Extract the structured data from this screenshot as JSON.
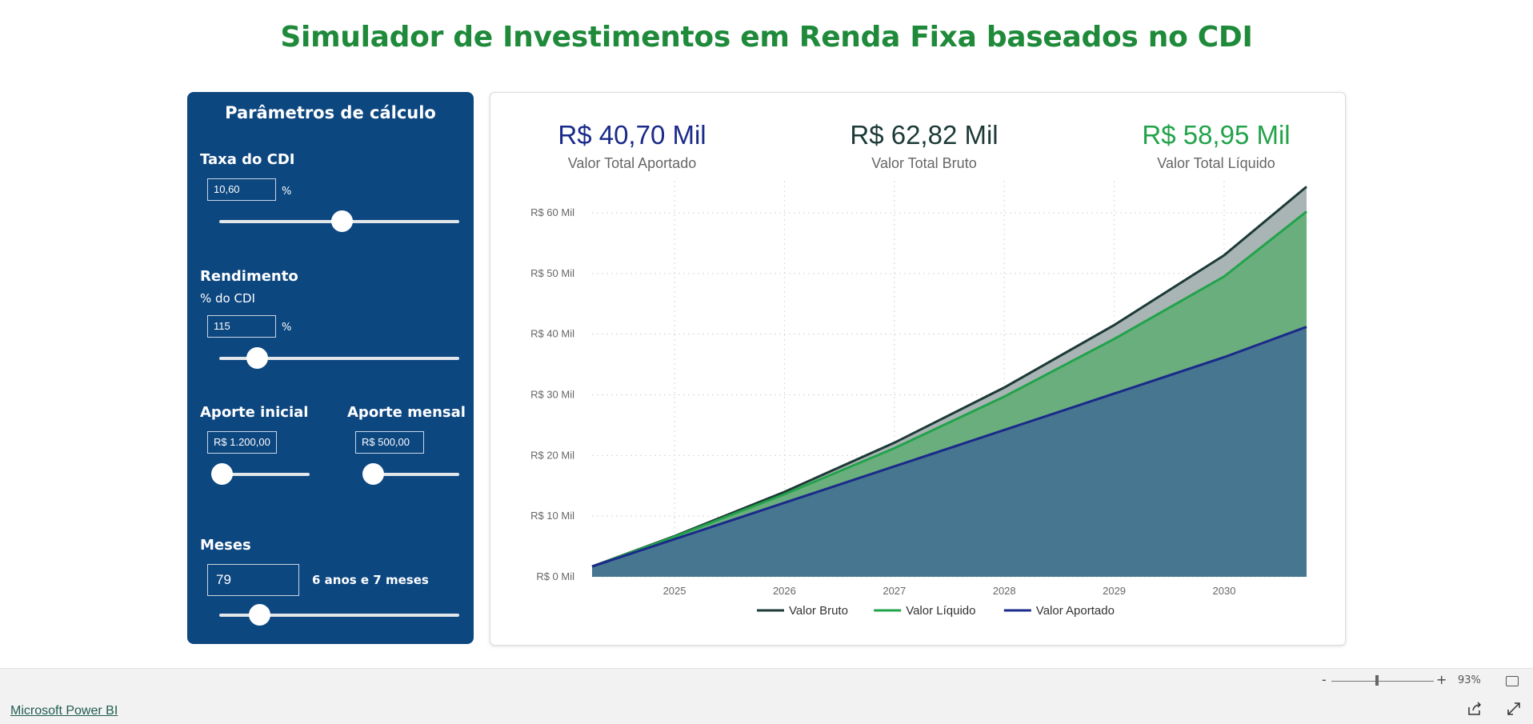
{
  "title": "Simulador de Investimentos em Renda Fixa baseados no CDI",
  "panel": {
    "title": "Parâmetros de cálculo",
    "cdi": {
      "label": "Taxa do CDI",
      "value": "10,60",
      "unit": "%",
      "slider_fraction": 0.51
    },
    "rendimento": {
      "label": "Rendimento",
      "sublabel": "% do CDI",
      "value": "115",
      "unit": "%",
      "slider_fraction": 0.16
    },
    "aporte_inicial": {
      "label": "Aporte inicial",
      "value": "R$ 1.200,00",
      "slider_fraction": 0.03
    },
    "aporte_mensal": {
      "label": "Aporte mensal",
      "value": "R$ 500,00",
      "slider_fraction": 0.13
    },
    "meses": {
      "label": "Meses",
      "value": "79",
      "description": "6 anos e 7 meses",
      "slider_fraction": 0.17
    }
  },
  "kpis": [
    {
      "value": "R$ 40,70 Mil",
      "label": "Valor Total Aportado",
      "color": "#1a2a8a"
    },
    {
      "value": "R$ 62,82 Mil",
      "label": "Valor Total Bruto",
      "color": "#1c3a36"
    },
    {
      "value": "R$ 58,95 Mil",
      "label": "Valor Total Líquido",
      "color": "#22a34a"
    }
  ],
  "chart_data": {
    "type": "area",
    "x_start": "2024-04",
    "x_end": "2030-10",
    "x_ticks": [
      "2025",
      "2026",
      "2027",
      "2028",
      "2029",
      "2030"
    ],
    "y_ticks": [
      "R$ 0 Mil",
      "R$ 10 Mil",
      "R$ 20 Mil",
      "R$ 30 Mil",
      "R$ 40 Mil",
      "R$ 50 Mil",
      "R$ 60 Mil"
    ],
    "ylim": [
      0,
      60
    ],
    "x": [
      "2024-04",
      "2025-01",
      "2026-01",
      "2027-01",
      "2028-01",
      "2029-01",
      "2030-01",
      "2030-10"
    ],
    "series": [
      {
        "name": "Valor Bruto",
        "color": "#1c3a36",
        "fill": "#a9b4b4",
        "values": [
          1.7,
          6.7,
          14.0,
          22.1,
          31.2,
          41.5,
          53.0,
          64.3
        ]
      },
      {
        "name": "Valor Líquido",
        "color": "#22a34a",
        "fill": "#6aae7e",
        "values": [
          1.7,
          6.6,
          13.6,
          21.2,
          29.7,
          39.2,
          49.5,
          60.2
        ]
      },
      {
        "name": "Valor Aportado",
        "color": "#1a2a8a",
        "fill": "#477690",
        "values": [
          1.7,
          6.2,
          12.2,
          18.2,
          24.2,
          30.2,
          36.2,
          41.2
        ]
      }
    ],
    "legend": "bottom-center"
  },
  "statusbar": {
    "zoom": "93%",
    "zoom_minus": "-",
    "zoom_plus": "+"
  },
  "footer": {
    "link": "Microsoft Power BI"
  }
}
